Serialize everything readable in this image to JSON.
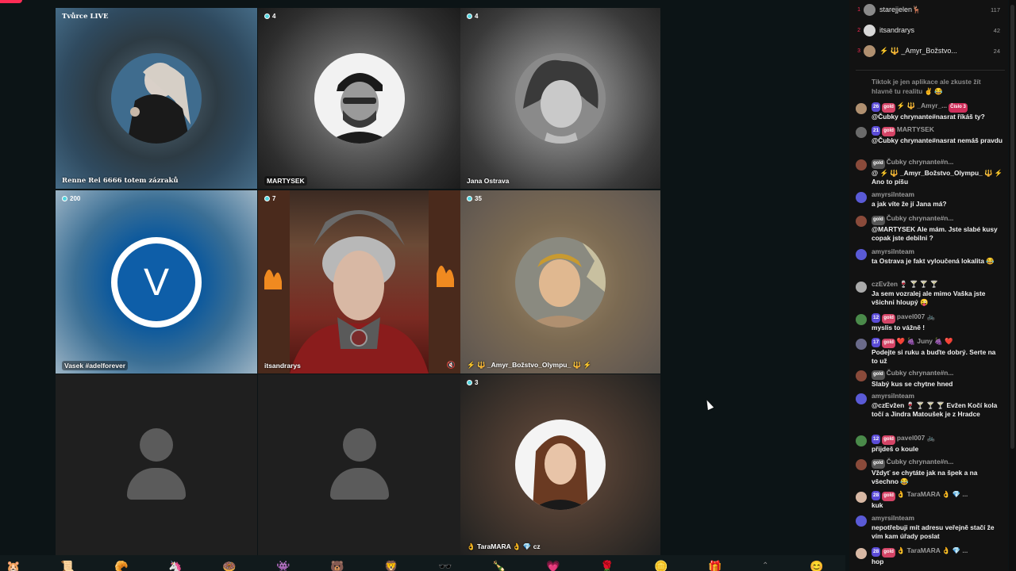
{
  "tiles": [
    {
      "id": "t1",
      "top_tag": "Tvůrce LIVE",
      "label": "Renne Rei 6666 totem zázraků"
    },
    {
      "id": "t2",
      "count": "4",
      "label": "MARTYSEK"
    },
    {
      "id": "t3",
      "count": "4",
      "label": "Jana Ostrava"
    },
    {
      "id": "t4",
      "count": "200",
      "label": "Vasek #adelforever",
      "avatar_letter": "V"
    },
    {
      "id": "t5",
      "count": "7",
      "label": "itsandrarys"
    },
    {
      "id": "t6",
      "count": "35",
      "label": "⚡ 🔱 _Amyr_Božstvo_Olympu_ 🔱 ⚡"
    },
    {
      "id": "t7"
    },
    {
      "id": "t8"
    },
    {
      "id": "t9",
      "count": "3",
      "label": "👌 TaraMARA 👌 💎 cz"
    }
  ],
  "ranking": [
    {
      "rank": "1",
      "name": "starejjelen🦌",
      "score": "117"
    },
    {
      "rank": "2",
      "name": "itsandrarys",
      "score": "42"
    },
    {
      "rank": "3",
      "name": "⚡ 🔱 _Amyr_Božstvo...",
      "score": "24"
    }
  ],
  "chat": [
    {
      "user": "",
      "text": "Tiktok je jen aplikace ale zkuste žít hlavně tu realitu ✌️ 😂"
    },
    {
      "level": "26",
      "badge": "gold",
      "user": "⚡ 🔱 _Amyr_...",
      "tag": "Číslo 3",
      "text": "@Čubky chrynante#nasrat říkáš ty?"
    },
    {
      "level": "21",
      "badge": "gold",
      "user": "MARTYSEK",
      "text": "@Čubky chrynante#nasrat nemáš pravdu"
    },
    {
      "badge": "gold",
      "user": "Čubky chrynante#n...",
      "text": "@ ⚡ 🔱 _Amyr_Božstvo_Olympu_ 🔱 ⚡ Ano to píšu"
    },
    {
      "user": "amyrsilnteam",
      "text": "a jak víte že jí Jana má?"
    },
    {
      "badge": "gold",
      "user": "Čubky chrynante#n...",
      "text": "@MARTYSEK Ale mám. Jste slabé kusy copak jste debilni ?"
    },
    {
      "user": "amyrsilnteam",
      "text": "ta Ostrava je fakt vyloučená lokalita 😂"
    },
    {
      "user": "czEvžen 🍷 🍸 🍸 🍸",
      "text": "Ja sem vozralej ale mimo Vaška jste všichni hloupý 😜"
    },
    {
      "level": "12",
      "badge": "gold",
      "user": "pavel007 🚲",
      "text": "myslis to vážně !"
    },
    {
      "level": "17",
      "badge": "gold",
      "user": "❤️ 🍇 Juny 🍇 ❤️",
      "text": "Podejte si ruku a buďte dobrý. Serte na to už"
    },
    {
      "badge": "gold",
      "user": "Čubky chrynante#n...",
      "text": "Slabý kus se chytne hned"
    },
    {
      "user": "amyrsilnteam",
      "text": "@czEvžen 🍷 🍸 🍸 🍸 Evžen Kočí kola točí a Jindra Matoušek je z Hradce"
    },
    {
      "level": "12",
      "badge": "gold",
      "user": "pavel007 🚲",
      "text": "přijdeš o koule"
    },
    {
      "badge": "gold",
      "user": "Čubky chrynante#n...",
      "text": "Vždyť se chytáte jak na špek a na všechno 😂"
    },
    {
      "level": "28",
      "badge": "gold",
      "user": "👌 TaraMARA 👌 💎 ...",
      "text": "kuk"
    },
    {
      "user": "amyrsilnteam",
      "text": "nepotřebuji mít adresu veřejně stačí že vím kam úřady poslat"
    },
    {
      "level": "28",
      "badge": "gold",
      "user": "👌 TaraMARA 👌 💎 ...",
      "text": "hop"
    }
  ],
  "gifts": [
    "🐹",
    "📜",
    "🥐",
    "🦄",
    "🍩",
    "👾",
    "🐻",
    "🦁",
    "🕶️",
    "🍾",
    "💗",
    "🌹",
    "🪙",
    "🎁",
    "⌃",
    "😊"
  ]
}
